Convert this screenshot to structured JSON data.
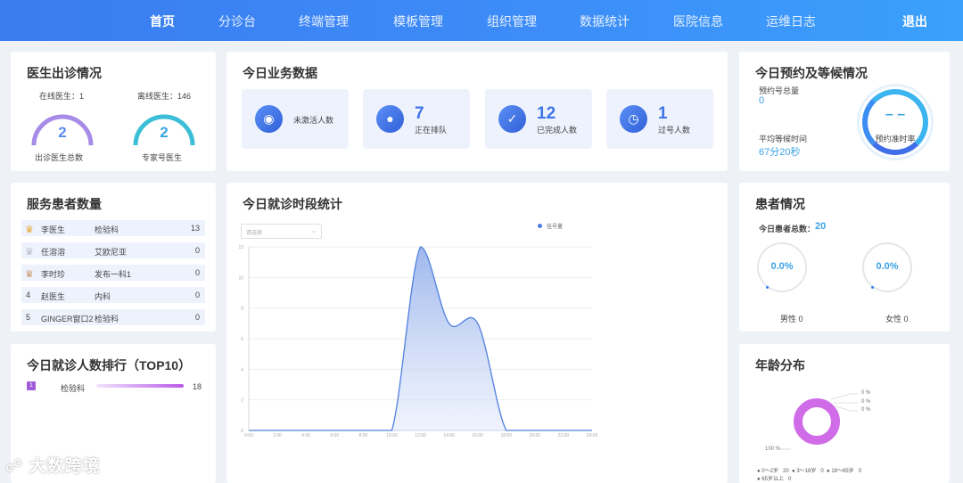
{
  "nav": {
    "items": [
      "首页",
      "分诊台",
      "终端管理",
      "模板管理",
      "组织管理",
      "数据统计",
      "医院信息",
      "运维日志"
    ],
    "active": "首页",
    "logout": "退出"
  },
  "doctor_visits": {
    "title": "医生出诊情况",
    "online_label": "在线医生：1",
    "offline_label": "离线医生：146",
    "total_value": "2",
    "total_label": "出诊医生总数",
    "expert_value": "2",
    "expert_label": "专家号医生"
  },
  "today_business": {
    "title": "今日业务数据",
    "boxes": [
      {
        "value": "",
        "label": "未激活人数",
        "icon": "lock-icon"
      },
      {
        "value": "7",
        "label": "正在排队",
        "icon": "users-icon"
      },
      {
        "value": "12",
        "label": "已完成人数",
        "icon": "checklist-icon"
      },
      {
        "value": "1",
        "label": "过号人数",
        "icon": "alarm-clock-icon"
      }
    ]
  },
  "appointment": {
    "title": "今日预约及等候情况",
    "total_label": "预约号总量",
    "total_value": "0",
    "wait_label": "平均等候时间",
    "wait_value": "67分20秒",
    "ring_value": "– –",
    "ring_label": "预约准时率"
  },
  "patients_served": {
    "title": "服务患者数量",
    "rows": [
      {
        "rank": "1",
        "name": "李医生",
        "dept": "检验科",
        "count": "13",
        "crown": "gold"
      },
      {
        "rank": "2",
        "name": "任溶溶",
        "dept": "艾欧尼亚",
        "count": "0",
        "crown": "silver"
      },
      {
        "rank": "3",
        "name": "李时珍",
        "dept": "发布一科1",
        "count": "0",
        "crown": "bronze"
      },
      {
        "rank": "4",
        "name": "赵医生",
        "dept": "内科",
        "count": "0",
        "crown": ""
      },
      {
        "rank": "5",
        "name": "GINGER窗口2",
        "dept": "检验科",
        "count": "0",
        "crown": ""
      }
    ]
  },
  "time_stats": {
    "title": "今日就诊时段统计",
    "select_placeholder": "请选择",
    "legend": "挂号量"
  },
  "chart_data": {
    "type": "area",
    "categories": [
      "0:00",
      "2:00",
      "4:00",
      "6:00",
      "8:00",
      "10:00",
      "12:00",
      "14:00",
      "16:00",
      "18:00",
      "20:00",
      "22:00",
      "24:00"
    ],
    "series": [
      {
        "name": "挂号量",
        "values": [
          0,
          0,
          0,
          0,
          0,
          0,
          12,
          7,
          7,
          0,
          0,
          0,
          0
        ]
      }
    ],
    "ylim": [
      0,
      12
    ],
    "yticks": [
      0,
      2,
      4,
      6,
      8,
      10,
      12
    ],
    "color": "#4f7fe0"
  },
  "ranking": {
    "title": "今日就诊人数排行（TOP10）",
    "rows": [
      {
        "rank": "1",
        "dept": "检验科",
        "count": "18",
        "fill": 1.0
      }
    ]
  },
  "patient_status": {
    "title": "患者情况",
    "total_label": "今日患者总数：",
    "total_value": "20",
    "male_pct": "0.0%",
    "male_label": "男性 0",
    "female_pct": "0.0%",
    "female_label": "女性 0"
  },
  "age_dist": {
    "title": "年龄分布",
    "pct_labels": [
      "0 %",
      "0 %",
      "0 %"
    ],
    "main_pct": "100 %",
    "legend": [
      {
        "label": "0～2岁",
        "value": "20"
      },
      {
        "label": "3～18岁",
        "value": "0"
      },
      {
        "label": "19～65岁",
        "value": "0"
      },
      {
        "label": "65岁以上",
        "value": "0"
      }
    ]
  },
  "watermark": "大数跨境"
}
